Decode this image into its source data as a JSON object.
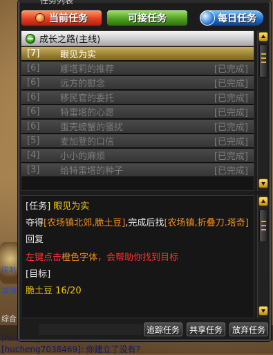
{
  "window": {
    "title": "任务列表"
  },
  "tabs": {
    "current": "当前任务",
    "available": "可接任务",
    "daily": "每日任务"
  },
  "quest_chain": {
    "title": "成长之路(主线)",
    "quests": [
      {
        "level": "[7]",
        "name": "眼见为实",
        "status": "",
        "selected": true
      },
      {
        "level": "[6]",
        "name": "娜塔莉的推荐",
        "status": "[已完成]",
        "selected": false
      },
      {
        "level": "[6]",
        "name": "远方的慰念",
        "status": "[已完成]",
        "selected": false
      },
      {
        "level": "[6]",
        "name": "移民官的委托",
        "status": "[已完成]",
        "selected": false
      },
      {
        "level": "[6]",
        "name": "特雷塔的心愿",
        "status": "[已完成]",
        "selected": false
      },
      {
        "level": "[6]",
        "name": "蛋壳螃蟹的骚扰",
        "status": "[已完成]",
        "selected": false
      },
      {
        "level": "[5]",
        "name": "麦加登的口信",
        "status": "[已完成]",
        "selected": false
      },
      {
        "level": "[4]",
        "name": "小小的麻烦",
        "status": "[已完成]",
        "selected": false
      },
      {
        "level": "[3]",
        "name": "给特雷塔的种子",
        "status": "[已完成]",
        "selected": false
      }
    ]
  },
  "detail": {
    "quest_tag": "[任务]",
    "quest_name": "眼见为实",
    "obtain_prefix": "夺得",
    "obtain_location": "[农场镇北郊,脆土豆]",
    "complete_text": ",完成后找",
    "npc_location": "[农场镇,折叠刀.塔奇]",
    "reply_label": "回复",
    "hint_red": "左键点击",
    "hint_orange": "橙色字体",
    "hint_red2": "，会帮助你找到目标",
    "target_label": "[目标]",
    "target_progress": "脆土豆 16/20"
  },
  "buttons": {
    "track": "追踪任务",
    "share": "共享任务",
    "abandon": "放弃任务"
  },
  "background": {
    "side_text_1": "闹叭",
    "side_text_2": "填咦",
    "side_text_3": "综合",
    "chat_1": "[hucheng7038469]: 你建立了没有?",
    "chat_2": "[hucheng7038469]: 你建立以后没有?"
  },
  "colors": {
    "accent_gold": "#c8b060",
    "quest_yellow": "#f0c800",
    "location_orange": "#f09020",
    "hint_red": "#ff3030"
  }
}
